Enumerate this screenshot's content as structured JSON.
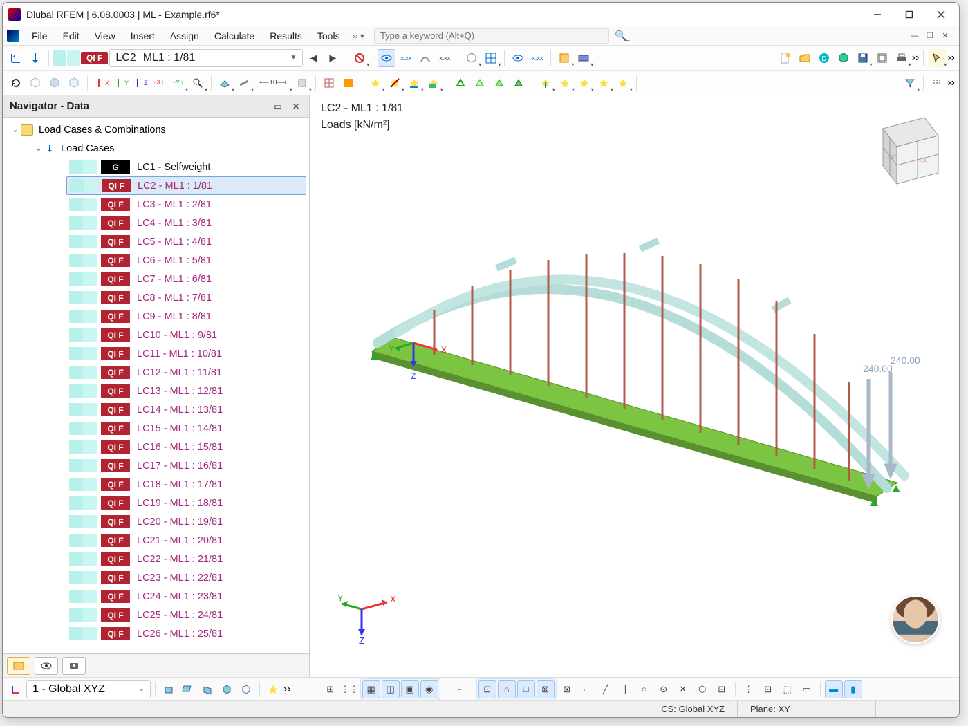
{
  "window": {
    "title": "Dlubal RFEM | 6.08.0003 | ML - Example.rf6*"
  },
  "menu": {
    "items": [
      "File",
      "Edit",
      "View",
      "Insert",
      "Assign",
      "Calculate",
      "Results",
      "Tools"
    ],
    "search_placeholder": "Type a keyword (Alt+Q)"
  },
  "load_selector": {
    "badge": "QI F",
    "code": "LC2",
    "name": "ML1 : 1/81"
  },
  "navigator": {
    "title": "Navigator - Data",
    "root": "Load Cases & Combinations",
    "group": "Load Cases",
    "first_item": {
      "badge": "G",
      "label": "LC1 - Selfweight"
    },
    "selected_index": 1,
    "lc_badge": "QI F",
    "items": [
      "LC2 - ML1 : 1/81",
      "LC3 - ML1 : 2/81",
      "LC4 - ML1 : 3/81",
      "LC5 - ML1 : 4/81",
      "LC6 - ML1 : 5/81",
      "LC7 - ML1 : 6/81",
      "LC8 - ML1 : 7/81",
      "LC9 - ML1 : 8/81",
      "LC10 - ML1 : 9/81",
      "LC11 - ML1 : 10/81",
      "LC12 - ML1 : 11/81",
      "LC13 - ML1 : 12/81",
      "LC14 - ML1 : 13/81",
      "LC15 - ML1 : 14/81",
      "LC16 - ML1 : 15/81",
      "LC17 - ML1 : 16/81",
      "LC18 - ML1 : 17/81",
      "LC19 - ML1 : 18/81",
      "LC20 - ML1 : 19/81",
      "LC21 - ML1 : 20/81",
      "LC22 - ML1 : 21/81",
      "LC23 - ML1 : 22/81",
      "LC24 - ML1 : 23/81",
      "LC25 - ML1 : 24/81",
      "LC26 - ML1 : 25/81"
    ]
  },
  "viewport": {
    "title": "LC2 - ML1 : 1/81",
    "subtitle": "Loads [kN/m²]",
    "load_values": [
      "240.00",
      "240.00"
    ],
    "axes": {
      "x": "X",
      "y": "Y",
      "z": "Z"
    },
    "cube_faces": {
      "x": "-X",
      "y": "-Y"
    }
  },
  "coord_system": {
    "label": "1 - Global XYZ"
  },
  "status": {
    "cs": "CS: Global XYZ",
    "plane": "Plane: XY"
  }
}
